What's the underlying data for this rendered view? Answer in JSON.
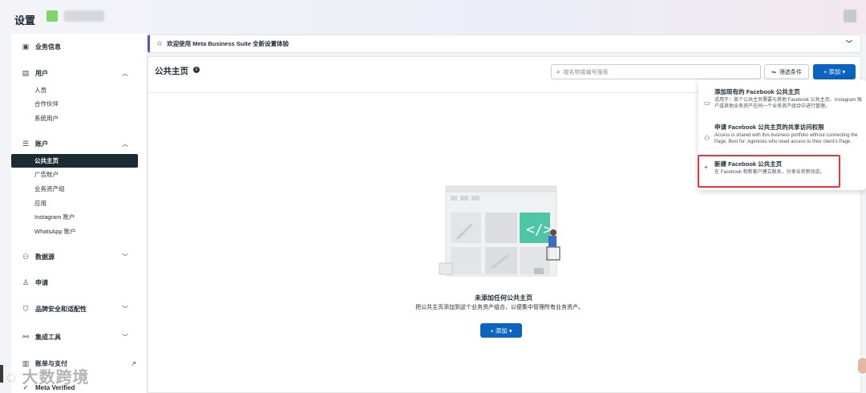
{
  "header": {
    "title": "设置"
  },
  "sidebar": {
    "groups": [
      {
        "label": "业务信息",
        "icon": "business-info-icon"
      },
      {
        "label": "用户",
        "icon": "users-icon",
        "items": [
          "人员",
          "合作伙伴",
          "系统用户"
        ]
      },
      {
        "label": "账户",
        "icon": "accounts-icon",
        "items": [
          "公共主页",
          "广告账户",
          "业务资产组",
          "应用",
          "Instagram 账户",
          "WhatsApp 账户"
        ]
      },
      {
        "label": "数据源",
        "icon": "data-sources-icon"
      },
      {
        "label": "申请",
        "icon": "requests-icon"
      },
      {
        "label": "品牌安全和适配性",
        "icon": "brand-safety-icon"
      },
      {
        "label": "集成工具",
        "icon": "integrations-icon"
      },
      {
        "label": "账单与支付",
        "icon": "billing-icon"
      },
      {
        "label": "Meta Verified",
        "icon": "verified-icon"
      }
    ]
  },
  "banner": {
    "text": "欢迎使用 Meta Business Suite 全新设置体验"
  },
  "main": {
    "title": "公共主页",
    "search_placeholder": "按名称或编号搜索",
    "filter_label": "筛选条件",
    "add_label": "添加",
    "empty_title": "未添加任何公共主页",
    "empty_desc": "把公共主页添加到这个业务资产组合，以便集中管理所有业务资产。",
    "empty_add_label": "添加"
  },
  "dropdown": {
    "items": [
      {
        "title": "添加现有的 Facebook 公共主页",
        "desc": "适用于：某个公共主页需要与其他 Facebook 公共主页、Instagram 账户或其他业务资产在同一个业务资产组合中进行管理。"
      },
      {
        "title": "申请 Facebook 公共主页的共享访问权限",
        "desc": "Access is shared with this business portfolio without connecting the Page. Best for: Agencies who need access to their client's Page."
      },
      {
        "title": "新建 Facebook 公共主页",
        "desc": "在 Facebook 和新客户建立联系，分享业务新动态。"
      }
    ]
  },
  "watermark": {
    "text": "大数跨境"
  },
  "colors": {
    "primary": "#0b64c0",
    "highlight": "#e0393e",
    "dark": "#1c2b33"
  }
}
